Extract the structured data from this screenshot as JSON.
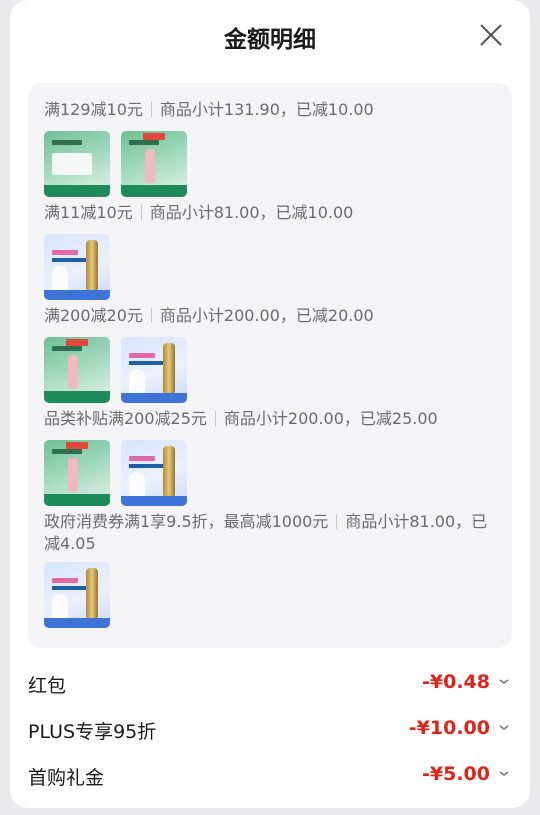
{
  "header": {
    "title": "金额明细"
  },
  "groups": [
    {
      "prefix": "满129减10元",
      "detail": "商品小计131.90，已减10.00",
      "products": [
        "green",
        "green"
      ]
    },
    {
      "prefix": "满11减10元",
      "detail": "商品小计81.00，已减10.00",
      "products": [
        "blue"
      ]
    },
    {
      "prefix": "满200减20元",
      "detail": "商品小计200.00，已减20.00",
      "products": [
        "green",
        "blue"
      ]
    },
    {
      "prefix": "品类补贴满200减25元",
      "detail": "商品小计200.00，已减25.00",
      "products": [
        "green",
        "blue"
      ]
    },
    {
      "prefix": "政府消费券满1享9.5折，最高减1000元",
      "detail": "商品小计81.00，已减4.05",
      "products": [
        "blue"
      ]
    }
  ],
  "rows": [
    {
      "label": "红包",
      "amount": "-¥0.48"
    },
    {
      "label": "PLUS专享95折",
      "amount": "-¥10.00"
    },
    {
      "label": "首购礼金",
      "amount": "-¥5.00"
    }
  ],
  "colors": {
    "discount_red": "#e2231a",
    "panel_bg": "#f4f4f6"
  },
  "icons": {
    "close": "close-icon",
    "expand": "chevron-down-icon"
  }
}
